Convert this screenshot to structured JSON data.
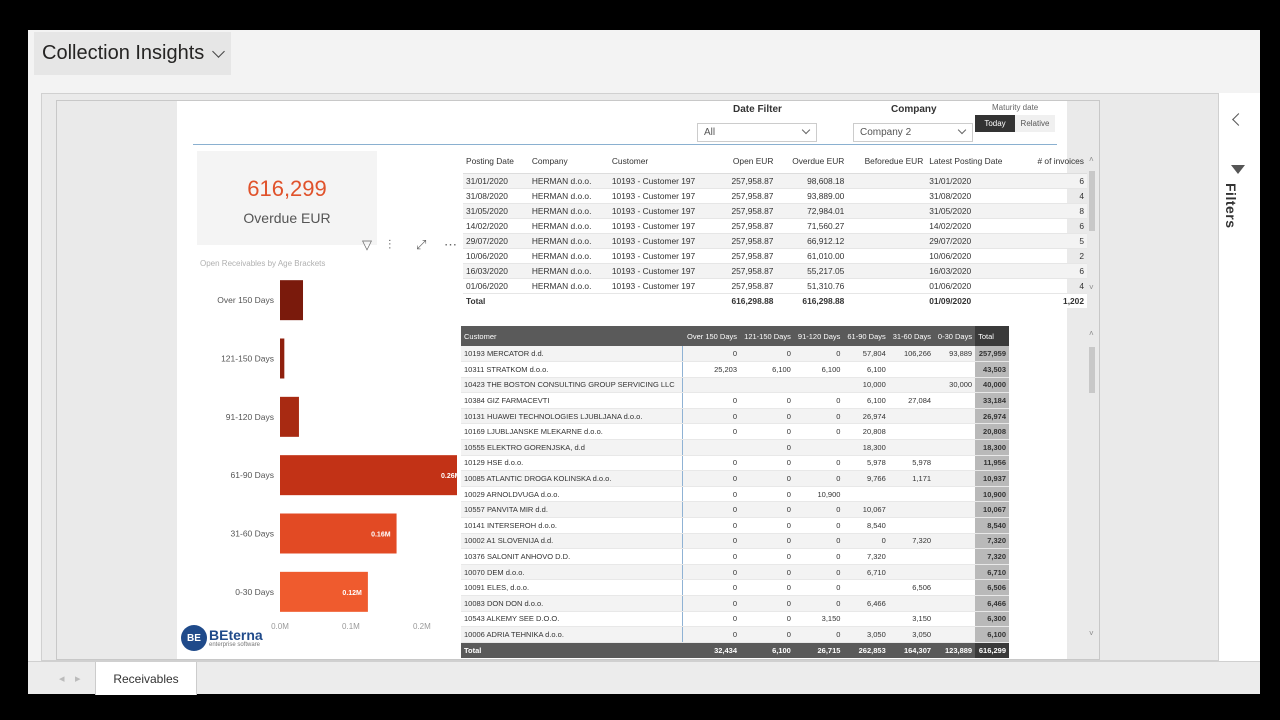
{
  "app": {
    "title": "Collection Insights"
  },
  "slicers": {
    "date_filter": {
      "label": "Date Filter",
      "value": "All"
    },
    "company": {
      "label": "Company",
      "value": "Company 2"
    },
    "maturity": {
      "label": "Maturity date",
      "options": [
        "Today",
        "Relative"
      ],
      "selected": "Today"
    }
  },
  "kpi": {
    "value": "616,299",
    "label": "Overdue EUR",
    "color": "#e0522b"
  },
  "age_chart": {
    "title": "Open Receivables by Age Brackets",
    "chart_data": {
      "type": "bar",
      "orientation": "horizontal",
      "categories": [
        "Over 150 Days",
        "121-150 Days",
        "91-120 Days",
        "61-90 Days",
        "31-60 Days",
        "0-30 Days"
      ],
      "values": [
        32434,
        6100,
        26715,
        262853,
        164307,
        123889
      ],
      "data_labels": [
        "",
        "",
        "",
        "0.26M",
        "0.16M",
        "0.12M"
      ],
      "colors": [
        "#7a1a0c",
        "#8f200e",
        "#a82a12",
        "#c23216",
        "#e24a24",
        "#ef5b2e"
      ],
      "xticks": [
        "0.0M",
        "0.1M",
        "0.2M"
      ],
      "xlim": [
        0,
        265000
      ],
      "title": "Open Receivables by Age Brackets"
    }
  },
  "visual_icons": [
    "filter-icon",
    "drill-icon",
    "focus-mode-icon",
    "more-options-icon"
  ],
  "invoice_table": {
    "headers": [
      "Posting Date",
      "Company",
      "Customer",
      "Open EUR",
      "Overdue EUR",
      "Beforedue EUR",
      "Latest Posting Date",
      "# of invoices"
    ],
    "rows": [
      [
        "31/01/2020",
        "HERMAN d.o.o.",
        "10193 - Customer 197",
        "257,958.87",
        "98,608.18",
        "",
        "31/01/2020",
        "6"
      ],
      [
        "31/08/2020",
        "HERMAN d.o.o.",
        "10193 - Customer 197",
        "257,958.87",
        "93,889.00",
        "",
        "31/08/2020",
        "4"
      ],
      [
        "31/05/2020",
        "HERMAN d.o.o.",
        "10193 - Customer 197",
        "257,958.87",
        "72,984.01",
        "",
        "31/05/2020",
        "8"
      ],
      [
        "14/02/2020",
        "HERMAN d.o.o.",
        "10193 - Customer 197",
        "257,958.87",
        "71,560.27",
        "",
        "14/02/2020",
        "6"
      ],
      [
        "29/07/2020",
        "HERMAN d.o.o.",
        "10193 - Customer 197",
        "257,958.87",
        "66,912.12",
        "",
        "29/07/2020",
        "5"
      ],
      [
        "10/06/2020",
        "HERMAN d.o.o.",
        "10193 - Customer 197",
        "257,958.87",
        "61,010.00",
        "",
        "10/06/2020",
        "2"
      ],
      [
        "16/03/2020",
        "HERMAN d.o.o.",
        "10193 - Customer 197",
        "257,958.87",
        "55,217.05",
        "",
        "16/03/2020",
        "6"
      ],
      [
        "01/06/2020",
        "HERMAN d.o.o.",
        "10193 - Customer 197",
        "257,958.87",
        "51,310.76",
        "",
        "01/06/2020",
        "4"
      ]
    ],
    "total": [
      "Total",
      "",
      "",
      "616,298.88",
      "616,298.88",
      "",
      "01/09/2020",
      "1,202"
    ]
  },
  "matrix": {
    "headers": [
      "Customer",
      "Over 150 Days",
      "121-150 Days",
      "91-120 Days",
      "61-90 Days",
      "31-60 Days",
      "0-30 Days",
      "Total"
    ],
    "rows": [
      [
        "10193 MERCATOR d.d.",
        "0",
        "0",
        "0",
        "57,804",
        "106,266",
        "93,889",
        "257,959"
      ],
      [
        "10311 STRATKOM d.o.o.",
        "25,203",
        "6,100",
        "6,100",
        "6,100",
        "",
        "",
        "43,503"
      ],
      [
        "10423 THE BOSTON CONSULTING GROUP SERVICING LLC",
        "",
        "",
        "",
        "10,000",
        "",
        "30,000",
        "40,000"
      ],
      [
        "10384 GIZ FARMACEVTI",
        "0",
        "0",
        "0",
        "6,100",
        "27,084",
        "",
        "33,184"
      ],
      [
        "10131 HUAWEI TECHNOLOGIES LJUBLJANA d.o.o.",
        "0",
        "0",
        "0",
        "26,974",
        "",
        "",
        "26,974"
      ],
      [
        "10169 LJUBLJANSKE MLEKARNE d.o.o.",
        "0",
        "0",
        "0",
        "20,808",
        "",
        "",
        "20,808"
      ],
      [
        "10555 ELEKTRO GORENJSKA, d.d",
        "",
        "0",
        "",
        "18,300",
        "",
        "",
        "18,300"
      ],
      [
        "10129 HSE d.o.o.",
        "0",
        "0",
        "0",
        "5,978",
        "5,978",
        "",
        "11,956"
      ],
      [
        "10085 ATLANTIC DROGA KOLINSKA d.o.o.",
        "0",
        "0",
        "0",
        "9,766",
        "1,171",
        "",
        "10,937"
      ],
      [
        "10029 ARNOLDVUGA d.o.o.",
        "0",
        "0",
        "10,900",
        "",
        "",
        "",
        "10,900"
      ],
      [
        "10557 PANVITA MIR d.d.",
        "0",
        "0",
        "0",
        "10,067",
        "",
        "",
        "10,067"
      ],
      [
        "10141 INTERSEROH d.o.o.",
        "0",
        "0",
        "0",
        "8,540",
        "",
        "",
        "8,540"
      ],
      [
        "10002 A1 SLOVENIJA d.d.",
        "0",
        "0",
        "0",
        "0",
        "7,320",
        "",
        "7,320"
      ],
      [
        "10376 SALONIT ANHOVO D.D.",
        "0",
        "0",
        "0",
        "7,320",
        "",
        "",
        "7,320"
      ],
      [
        "10070 DEM d.o.o.",
        "0",
        "0",
        "0",
        "6,710",
        "",
        "",
        "6,710"
      ],
      [
        "10091 ELES, d.o.o.",
        "0",
        "0",
        "0",
        "",
        "6,506",
        "",
        "6,506"
      ],
      [
        "10083 DON DON d.o.o.",
        "0",
        "0",
        "0",
        "6,466",
        "",
        "",
        "6,466"
      ],
      [
        "10543 ALKEMY SEE D.O.O.",
        "0",
        "0",
        "3,150",
        "",
        "3,150",
        "",
        "6,300"
      ],
      [
        "10006 ADRIA TEHNIKA d.o.o.",
        "0",
        "0",
        "0",
        "3,050",
        "3,050",
        "",
        "6,100"
      ]
    ],
    "total": [
      "Total",
      "32,434",
      "6,100",
      "26,715",
      "262,853",
      "164,307",
      "123,889",
      "616,299"
    ]
  },
  "logo": {
    "name": "BEterna",
    "tagline": "enterprise software"
  },
  "filters_pane": {
    "label": "Filters"
  },
  "pages": [
    {
      "label": "Receivables",
      "active": true
    }
  ]
}
